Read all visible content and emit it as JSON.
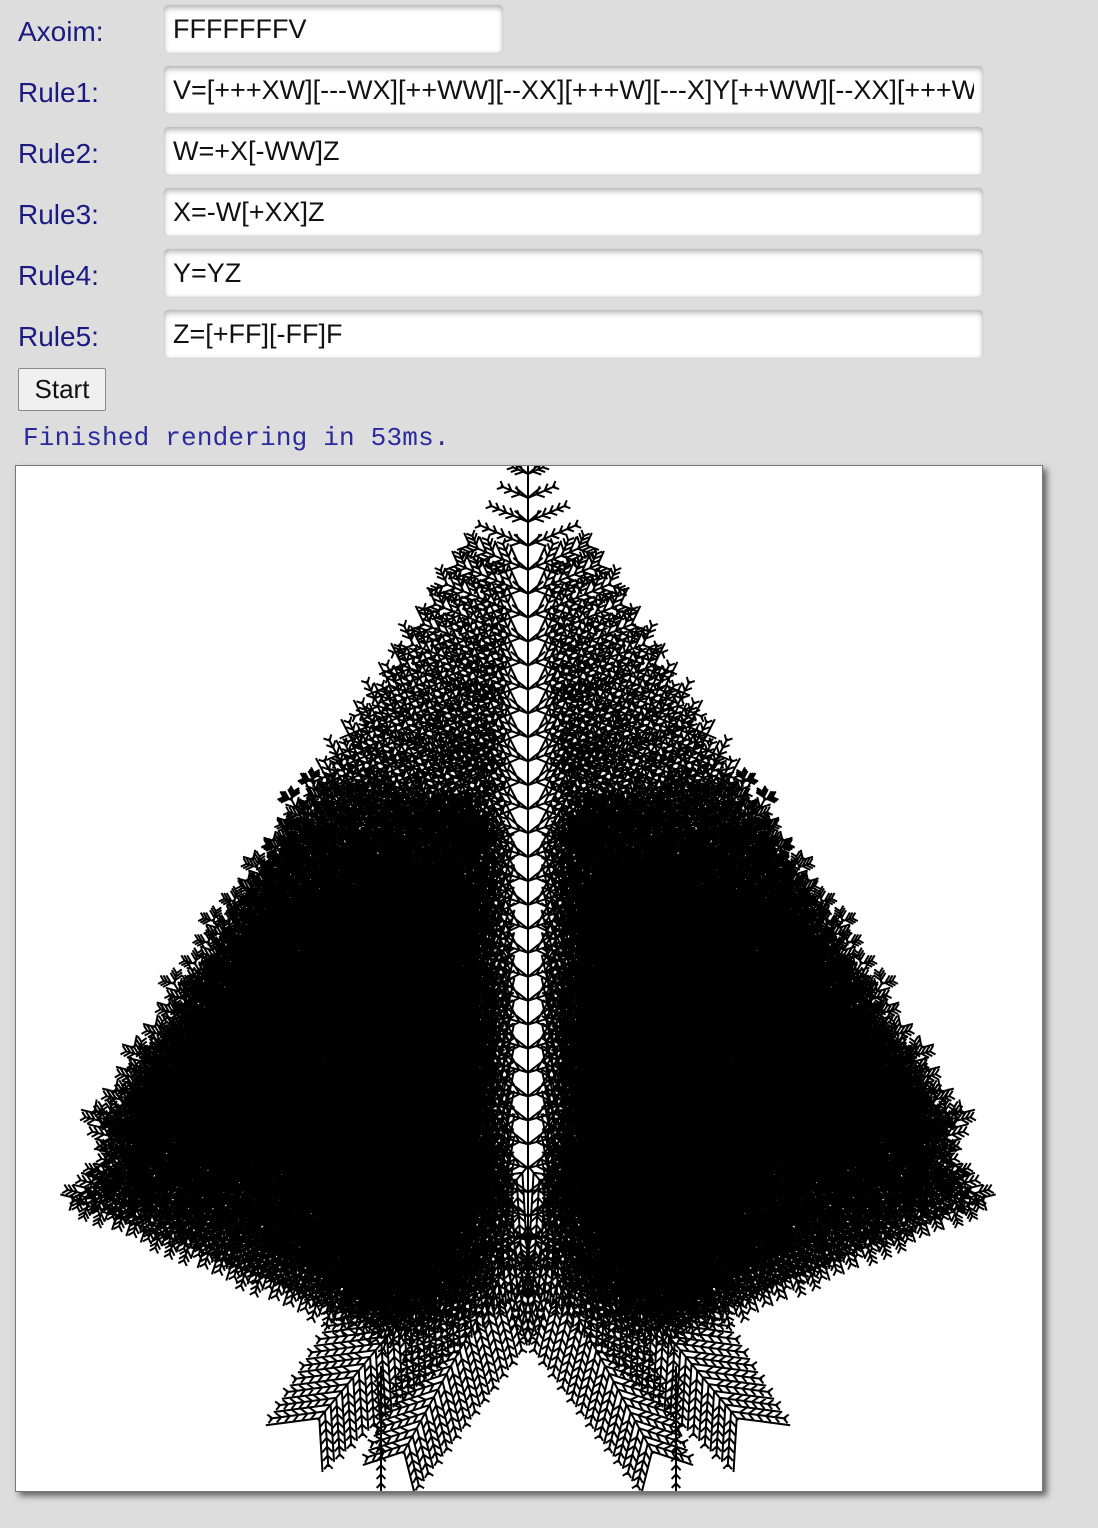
{
  "form": {
    "axiom": {
      "label": "Axoim:",
      "value": "FFFFFFFV"
    },
    "rules": [
      {
        "label": "Rule1:",
        "value": "V=[+++XW][---WX][++WW][--XX][+++W][---X]Y[++WW][--XX][+++W]"
      },
      {
        "label": "Rule2:",
        "value": "W=+X[-WW]Z"
      },
      {
        "label": "Rule3:",
        "value": "X=-W[+XX]Z"
      },
      {
        "label": "Rule4:",
        "value": "Y=YZ"
      },
      {
        "label": "Rule5:",
        "value": "Z=[+FF][-FF]F"
      }
    ]
  },
  "start_button": {
    "label": "Start"
  },
  "status": {
    "text": "Finished rendering in 53ms."
  },
  "canvas": {
    "background": "#ffffff",
    "stroke_color": "#000000"
  }
}
